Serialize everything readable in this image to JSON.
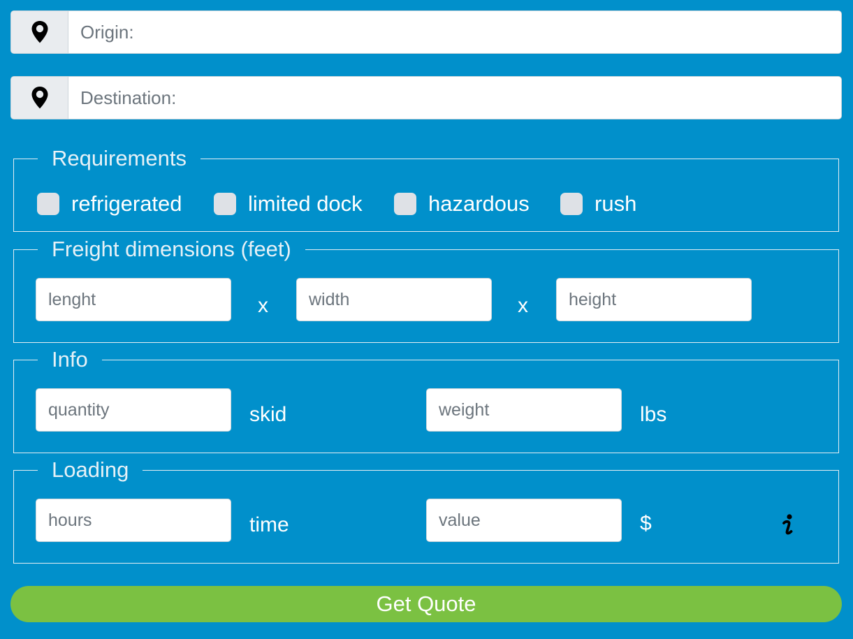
{
  "origin": {
    "placeholder": "Origin:"
  },
  "destination": {
    "placeholder": "Destination:"
  },
  "requirements": {
    "legend": "Requirements",
    "options": [
      "refrigerated",
      "limited dock",
      "hazardous",
      "rush"
    ]
  },
  "dimensions": {
    "legend": "Freight dimensions (feet)",
    "length_placeholder": "lenght",
    "width_placeholder": "width",
    "height_placeholder": "height",
    "separator": "x"
  },
  "info": {
    "legend": "Info",
    "quantity_placeholder": "quantity",
    "quantity_unit": "skid",
    "weight_placeholder": "weight",
    "weight_unit": "lbs"
  },
  "loading": {
    "legend": "Loading",
    "hours_placeholder": "hours",
    "hours_unit": "time",
    "value_placeholder": "value",
    "value_unit": "$",
    "info_icon": "info-icon"
  },
  "submit": {
    "label": "Get Quote"
  },
  "colors": {
    "background": "#0190cb",
    "button": "#7bc142",
    "checkbox": "#dee1e6",
    "addon": "#e9ecef"
  }
}
